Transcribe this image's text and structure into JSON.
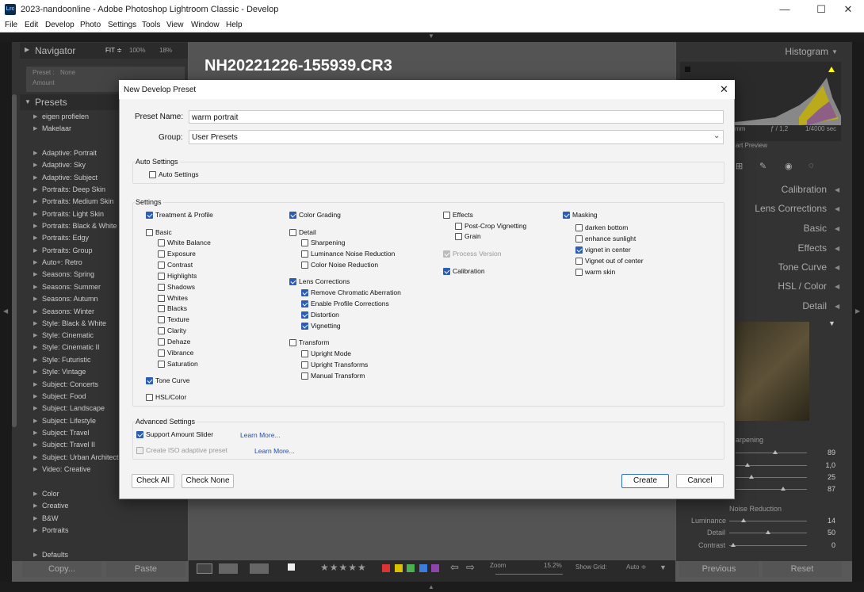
{
  "window": {
    "title": "2023-nandoonline - Adobe Photoshop Lightroom Classic - Develop",
    "app_icon": "Lrc",
    "min": "—",
    "max": "☐",
    "close": "✕"
  },
  "menu": [
    "File",
    "Edit",
    "Develop",
    "Photo",
    "Settings",
    "Tools",
    "View",
    "Window",
    "Help"
  ],
  "navigator": {
    "title": "Navigator",
    "fit": "FIT ≑",
    "p100": "100%",
    "p18": "18%",
    "preset_label": "Preset :",
    "preset_value": "None",
    "amount_label": "Amount"
  },
  "presets": {
    "title": "Presets",
    "items": [
      "eigen profielen",
      "Makelaar",
      "Adaptive: Portrait",
      "Adaptive: Sky",
      "Adaptive: Subject",
      "Portraits: Deep Skin",
      "Portraits: Medium Skin",
      "Portraits: Light Skin",
      "Portraits: Black & White",
      "Portraits: Edgy",
      "Portraits: Group",
      "Auto+: Retro",
      "Seasons: Spring",
      "Seasons: Summer",
      "Seasons: Autumn",
      "Seasons: Winter",
      "Style: Black & White",
      "Style: Cinematic",
      "Style: Cinematic II",
      "Style: Futuristic",
      "Style: Vintage",
      "Subject: Concerts",
      "Subject: Food",
      "Subject: Landscape",
      "Subject: Lifestyle",
      "Subject: Travel",
      "Subject: Travel II",
      "Subject: Urban Architectu",
      "Video: Creative",
      "Color",
      "Creative",
      "B&W",
      "Portraits",
      "Defaults"
    ]
  },
  "left_buttons": {
    "copy": "Copy...",
    "paste": "Paste"
  },
  "image": {
    "filename": "NH20221226-155939.CR3"
  },
  "toolbar": {
    "zoom_label": "Zoom",
    "zoom_value": "15.2%",
    "grid_label": "Show Grid:",
    "grid_value": "Auto ≑",
    "stars": "★★★★★",
    "colors": [
      "#d33",
      "#d9c100",
      "#4caf50",
      "#3b7dd8",
      "#8e44ad"
    ]
  },
  "right": {
    "histogram": "Histogram",
    "info": [
      "mm",
      "ƒ / 1,2",
      "1/4000 sec"
    ],
    "smart_preview": "art Preview",
    "sections": [
      "Calibration",
      "Lens Corrections",
      "Basic",
      "Effects",
      "Tone Curve",
      "HSL / Color",
      "Detail"
    ],
    "sharpening": "arpening",
    "sharp_values": [
      "89",
      "1,0",
      "25",
      "87"
    ],
    "noise_title": "Noise Reduction",
    "noise": [
      {
        "label": "Luminance",
        "value": "14"
      },
      {
        "label": "Detail",
        "value": "50"
      },
      {
        "label": "Contrast",
        "value": "0"
      }
    ],
    "previous": "Previous",
    "reset": "Reset"
  },
  "dialog": {
    "title": "New Develop Preset",
    "close": "✕",
    "preset_name_label": "Preset Name:",
    "preset_name_value": "warm portrait",
    "group_label": "Group:",
    "group_value": "User Presets",
    "auto_settings_title": "Auto Settings",
    "auto_settings_cb": "Auto Settings",
    "settings_title": "Settings",
    "col1": {
      "treatment": "Treatment & Profile",
      "basic": "Basic",
      "basic_items": [
        "White Balance",
        "Exposure",
        "Contrast",
        "Highlights",
        "Shadows",
        "Whites",
        "Blacks",
        "Texture",
        "Clarity",
        "Dehaze",
        "Vibrance",
        "Saturation"
      ],
      "tone_curve": "Tone Curve",
      "hsl": "HSL/Color"
    },
    "col2": {
      "color_grading": "Color Grading",
      "detail": "Detail",
      "detail_items": [
        "Sharpening",
        "Luminance Noise Reduction",
        "Color Noise Reduction"
      ],
      "lens": "Lens Corrections",
      "lens_items": [
        "Remove Chromatic Aberration",
        "Enable Profile Corrections",
        "Distortion",
        "Vignetting"
      ],
      "transform": "Transform",
      "transform_items": [
        "Upright Mode",
        "Upright Transforms",
        "Manual Transform"
      ]
    },
    "col3": {
      "effects": "Effects",
      "effects_items": [
        "Post-Crop Vignetting",
        "Grain"
      ],
      "process": "Process Version",
      "calibration": "Calibration"
    },
    "col4": {
      "masking": "Masking",
      "masking_items": [
        "darken bottom",
        "enhance sunlight",
        "vignet in center",
        "Vignet out of center",
        "warm skin"
      ]
    },
    "advanced_title": "Advanced Settings",
    "support_amount": "Support Amount Slider",
    "learn_more1": "Learn More...",
    "iso": "Create ISO adaptive preset",
    "learn_more2": "Learn More...",
    "check_all": "Check All",
    "check_none": "Check None",
    "create": "Create",
    "cancel": "Cancel"
  }
}
